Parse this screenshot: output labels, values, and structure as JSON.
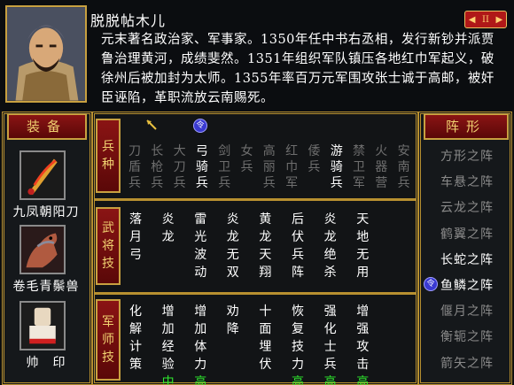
{
  "bio": {
    "name": "脱脱帖木儿",
    "text": "元末著名政治家、军事家。1350年任中书右丞相，发行新钞并派贾鲁治理黄河，成绩斐然。1351年组织军队镇压各地红巾军起义，破徐州后被加封为太师。1355年率百万元军围攻张士诚于高邮，被奸臣诬陷，革职流放云南赐死。",
    "nav_prev": "◀",
    "nav_pause": "II",
    "nav_next": "▶"
  },
  "equipment": {
    "title": "装备",
    "items": [
      {
        "label": "九凤朝阳刀",
        "icon": "sword-icon"
      },
      {
        "label": "卷毛青鬃兽",
        "icon": "horse-icon"
      },
      {
        "label": "帅　印",
        "icon": "seal-icon"
      }
    ]
  },
  "formation": {
    "title": "阵形",
    "items": [
      {
        "label": "方形之阵",
        "state": "dim"
      },
      {
        "label": "车悬之阵",
        "state": "dim"
      },
      {
        "label": "云龙之阵",
        "state": "dim"
      },
      {
        "label": "鹤翼之阵",
        "state": "dim"
      },
      {
        "label": "长蛇之阵",
        "state": "active"
      },
      {
        "label": "鱼鳞之阵",
        "state": "selected"
      },
      {
        "label": "偃月之阵",
        "state": "dim"
      },
      {
        "label": "衡轭之阵",
        "state": "dim"
      },
      {
        "label": "箭矢之阵",
        "state": "dim"
      }
    ],
    "selected_marker": "令"
  },
  "sections": {
    "troops_tab": "兵种",
    "skills_tab": "武将技",
    "strategy_tab": "军师技",
    "troops_marker": "令"
  },
  "troops": [
    {
      "chars": [
        "刀",
        "盾",
        "兵"
      ],
      "on": false
    },
    {
      "chars": [
        "长",
        "枪",
        "兵"
      ],
      "on": false
    },
    {
      "chars": [
        "大",
        "刀",
        "兵"
      ],
      "on": false
    },
    {
      "chars": [
        "弓",
        "骑",
        "兵"
      ],
      "on": true
    },
    {
      "chars": [
        "剑",
        "卫",
        "兵"
      ],
      "on": false
    },
    {
      "chars": [
        "女",
        "兵",
        ""
      ],
      "on": false
    },
    {
      "chars": [
        "高",
        "丽",
        "兵"
      ],
      "on": false
    },
    {
      "chars": [
        "红",
        "巾",
        "军"
      ],
      "on": false
    },
    {
      "chars": [
        "倭",
        "兵",
        ""
      ],
      "on": false
    },
    {
      "chars": [
        "游",
        "骑",
        "兵"
      ],
      "on": true
    },
    {
      "chars": [
        "禁",
        "卫",
        "军"
      ],
      "on": false
    },
    {
      "chars": [
        "火",
        "器",
        "营"
      ],
      "on": false
    },
    {
      "chars": [
        "安",
        "南",
        "兵"
      ],
      "on": false
    }
  ],
  "skills": [
    [
      "落",
      "月",
      "弓",
      ""
    ],
    [
      "炎",
      "龙",
      "",
      ""
    ],
    [
      "雷",
      "光",
      "波",
      "动"
    ],
    [
      "炎",
      "龙",
      "无",
      "双"
    ],
    [
      "黄",
      "龙",
      "天",
      "翔"
    ],
    [
      "后",
      "伏",
      "兵",
      "阵"
    ],
    [
      "炎",
      "龙",
      "绝",
      "杀"
    ],
    [
      "天",
      "地",
      "无",
      "用"
    ]
  ],
  "strategies": [
    {
      "chars": [
        "化",
        "解",
        "计",
        "策"
      ],
      "hi": ""
    },
    {
      "chars": [
        "增",
        "加",
        "经",
        "验"
      ],
      "hi": "中"
    },
    {
      "chars": [
        "增",
        "加",
        "体",
        "力"
      ],
      "hi": "高"
    },
    {
      "chars": [
        "劝",
        "降",
        "",
        ""
      ],
      "hi": ""
    },
    {
      "chars": [
        "十",
        "面",
        "埋",
        "伏"
      ],
      "hi": ""
    },
    {
      "chars": [
        "恢",
        "复",
        "技",
        "力"
      ],
      "hi": "高"
    },
    {
      "chars": [
        "强",
        "化",
        "士",
        "兵"
      ],
      "hi": "高"
    },
    {
      "chars": [
        "增",
        "强",
        "攻",
        "击"
      ],
      "hi": "高"
    }
  ],
  "colors": {
    "frame_gold": "#b89030",
    "plate_red": "#8a1414",
    "text_dim": "#6e6e6e",
    "level_green": "#2ee82e"
  }
}
